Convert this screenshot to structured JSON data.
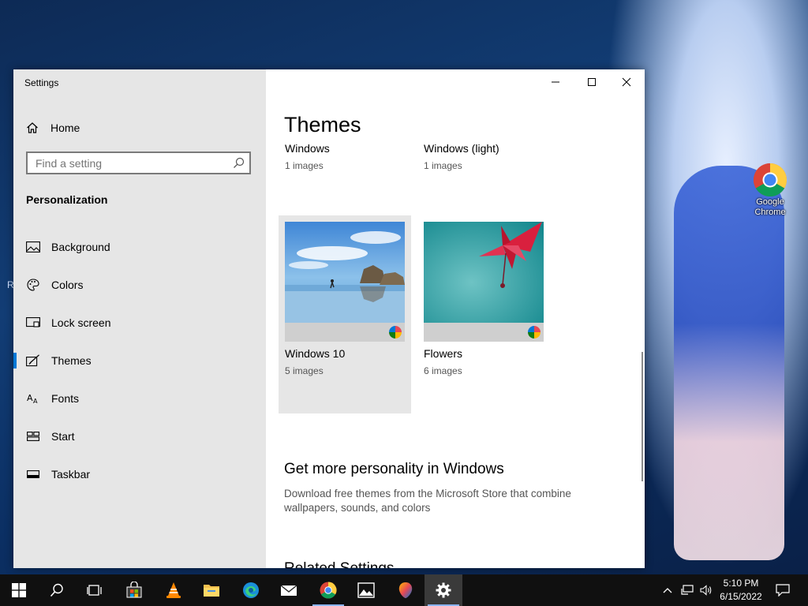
{
  "desktop": {
    "left_edge_text": "R",
    "icons": [
      {
        "label": "Google Chrome",
        "icon": "chrome-icon"
      }
    ]
  },
  "window": {
    "title": "Settings",
    "controls": {
      "minimize": "minimize-icon",
      "maximize": "maximize-icon",
      "close": "close-icon"
    }
  },
  "sidebar": {
    "home_label": "Home",
    "search_placeholder": "Find a setting",
    "section_title": "Personalization",
    "items": [
      {
        "label": "Background",
        "icon": "picture-icon"
      },
      {
        "label": "Colors",
        "icon": "palette-icon"
      },
      {
        "label": "Lock screen",
        "icon": "lock-screen-icon"
      },
      {
        "label": "Themes",
        "icon": "brush-icon",
        "active": true
      },
      {
        "label": "Fonts",
        "icon": "font-icon"
      },
      {
        "label": "Start",
        "icon": "start-icon"
      },
      {
        "label": "Taskbar",
        "icon": "taskbar-icon"
      }
    ]
  },
  "main": {
    "title": "Themes",
    "themes": [
      {
        "name": "Windows",
        "count": "1 images"
      },
      {
        "name": "Windows (light)",
        "count": "1 images"
      },
      {
        "name": "Windows 10",
        "count": "5 images",
        "selected": true
      },
      {
        "name": "Flowers",
        "count": "6 images"
      }
    ],
    "more_heading": "Get more personality in Windows",
    "more_text": "Download free themes from the Microsoft Store that combine wallpapers, sounds, and colors",
    "related_heading": "Related Settings"
  },
  "taskbar": {
    "apps": [
      "start-icon",
      "search-icon",
      "task-view-icon",
      "store-icon",
      "vlc-icon",
      "file-explorer-icon",
      "edge-icon",
      "mail-icon",
      "chrome-icon",
      "photos-icon",
      "paint3d-icon",
      "settings-icon"
    ],
    "time": "5:10 PM",
    "date": "6/15/2022"
  },
  "colors": {
    "accent": "#0078d7",
    "sidebar_bg": "#e6e6e6",
    "taskbar_bg": "#101010"
  }
}
